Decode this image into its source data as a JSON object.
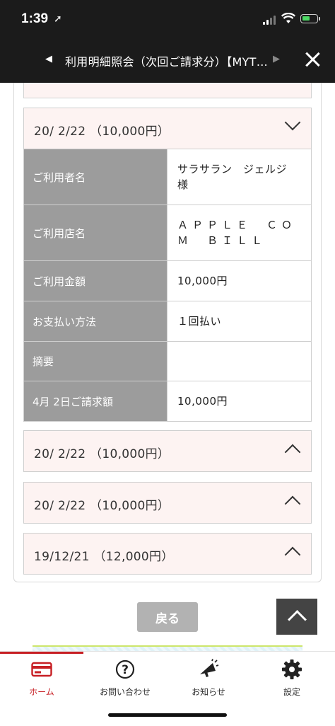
{
  "status_bar": {
    "time": "1:39",
    "location_glyph": "➚"
  },
  "nav": {
    "title": "利用明細照会（次回ご請求分）【MYT…",
    "prev_glyph": "◀",
    "next_glyph": "▶"
  },
  "transactions": [
    {
      "label": "20/ 2/22 （10,000円）",
      "expanded": true,
      "details": [
        {
          "label": "ご利用者名",
          "value": "サラサラン　ジェルジ　様"
        },
        {
          "label": "ご利用店名",
          "value": "ＡＰＰＬＥ　ＣＯＭ　ＢＩＬＬ"
        },
        {
          "label": "ご利用金額",
          "value": "10,000円"
        },
        {
          "label": "お支払い方法",
          "value": "１回払い"
        },
        {
          "label": "摘要",
          "value": ""
        },
        {
          "label": "4月 2日ご請求額",
          "value": "10,000円"
        }
      ]
    },
    {
      "label": "20/ 2/22 （10,000円）",
      "expanded": false
    },
    {
      "label": "20/ 2/22 （10,000円）",
      "expanded": false
    },
    {
      "label": "19/12/21 （12,000円）",
      "expanded": false
    }
  ],
  "buttons": {
    "back_label": "戻る"
  },
  "tabbar": {
    "accent_color": "#c71f24",
    "items": [
      {
        "label": "ホーム",
        "icon": "credit-card-icon",
        "active": true
      },
      {
        "label": "お問い合わせ",
        "icon": "question-circle-icon",
        "active": false
      },
      {
        "label": "お知らせ",
        "icon": "megaphone-icon",
        "active": false
      },
      {
        "label": "設定",
        "icon": "gear-icon",
        "active": false
      }
    ]
  },
  "colors": {
    "header_bg": "#1b1b1b",
    "card_bg": "#fdf3f2",
    "label_cell_bg": "#9c9c9c",
    "back_button_bg": "#b2b2b2"
  }
}
